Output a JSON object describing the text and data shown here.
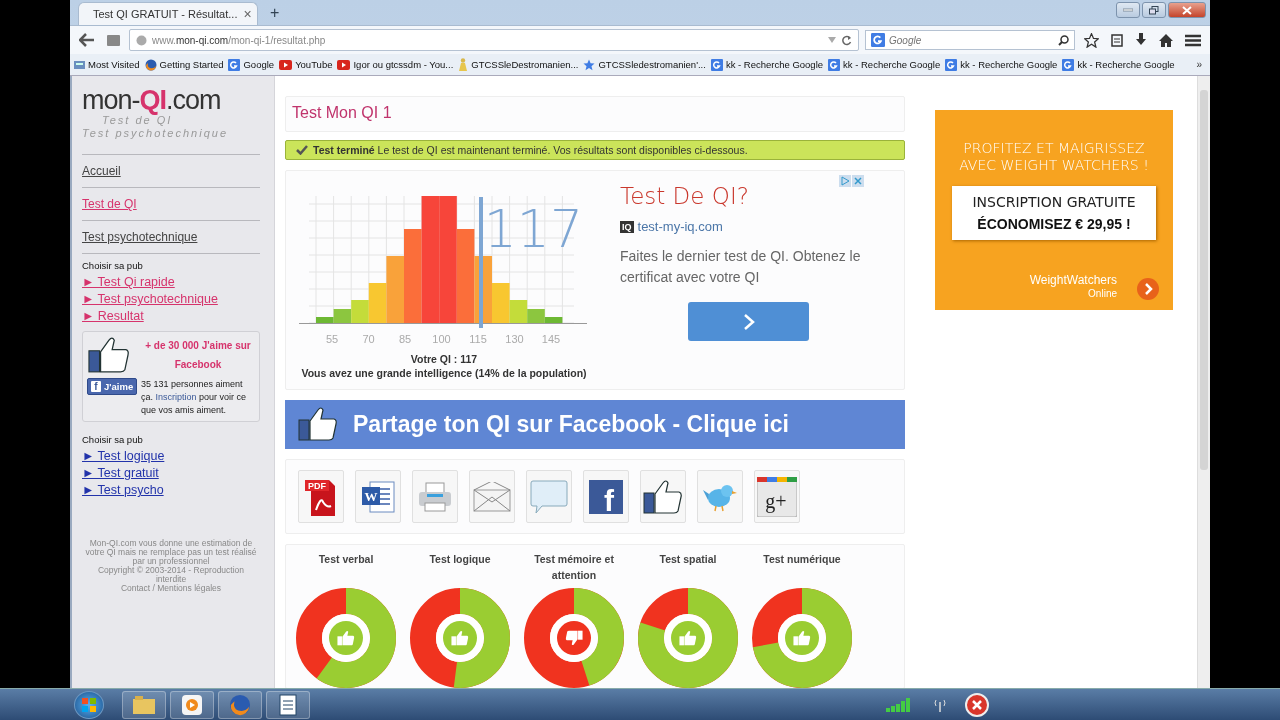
{
  "browser": {
    "tab": {
      "title": "Test QI GRATUIT - Résultat...",
      "close": "×"
    },
    "new_tab": "+",
    "url": "www.**mon-qi.com**/mon-qi-1/resultat.php",
    "search": {
      "placeholder": "Google"
    },
    "bookmarks": [
      {
        "kind": "folder",
        "label": "Most Visited"
      },
      {
        "kind": "firefox",
        "label": "Getting Started"
      },
      {
        "kind": "google",
        "label": "Google"
      },
      {
        "kind": "youtube",
        "label": "YouTube"
      },
      {
        "kind": "youtube",
        "label": "Igor ou gtcssdm - You..."
      },
      {
        "kind": "figure",
        "label": "GTCSSleDestromanien..."
      },
      {
        "kind": "star",
        "label": "GTCSSledestromanien'..."
      },
      {
        "kind": "google",
        "label": "kk - Recherche Google"
      },
      {
        "kind": "google",
        "label": "kk - Recherche Google"
      },
      {
        "kind": "google",
        "label": "kk - Recherche Google"
      },
      {
        "kind": "google",
        "label": "kk - Recherche Google"
      }
    ],
    "bookmarks_more": "»"
  },
  "sidebar": {
    "logo": {
      "left": "mon-",
      "mark": "QI",
      "right": ".com",
      "taglines": [
        "Test de QI",
        "Test psychotechnique"
      ]
    },
    "nav": [
      {
        "label": "Accueil",
        "selected": false
      },
      {
        "label": "Test de QI",
        "selected": true
      },
      {
        "label": "Test psychotechnique",
        "selected": false
      }
    ],
    "ad_groups": [
      {
        "label": "Choisir sa pub",
        "color": "#d6336c",
        "links": [
          "► Test Qi rapide",
          "► Test psychotechnique",
          "► Resultat"
        ]
      },
      {
        "label": "Choisir sa pub",
        "color": "#2233aa",
        "links": [
          "► Test logique",
          "► Test gratuit",
          "► Test psycho"
        ]
      }
    ],
    "facebook_box": {
      "headline": "+ de 30 000 J'aime sur Facebook",
      "like_button": {
        "glyph": "f",
        "label": "J'aime"
      },
      "count_text": "35 131 personnes aiment ça.",
      "link": "Inscription",
      "after_link": "pour voir ce que vos amis aiment."
    },
    "footer": [
      "Mon-QI.com vous donne une estimation de votre QI mais ne remplace pas un test réalisé par un professionnel",
      "Copyright © 2003-2014 - Reproduction interdite",
      "Contact / Mentions légales"
    ]
  },
  "main": {
    "title": "Test Mon QI 1",
    "alert": "**Test terminé** Le test de QI est maintenant terminé. Vos résultats sont disponibles ci-dessous.",
    "result": {
      "score": "117",
      "axis_labels": [
        "55",
        "70",
        "85",
        "100",
        "115",
        "130",
        "145"
      ],
      "caption": "Votre QI : 117",
      "summary": "Vous avez une grande intelligence (14% de la population)"
    },
    "ad": {
      "title": "Test De QI?",
      "badge": "IQ",
      "domain": "test-my-iq.com",
      "text": "Faites le dernier test de QI. Obtenez le certificat avec votre QI"
    },
    "share_banner": "Partage ton QI sur Facebook - Clique ici",
    "share_buttons": [
      {
        "kind": "pdf",
        "glyph": "PDF"
      },
      {
        "kind": "word",
        "glyph": "W"
      },
      {
        "kind": "print"
      },
      {
        "kind": "mail"
      },
      {
        "kind": "comment"
      },
      {
        "kind": "facebook",
        "glyph": "f"
      },
      {
        "kind": "like"
      },
      {
        "kind": "bird"
      },
      {
        "kind": "googleplus",
        "glyph": "g+"
      }
    ],
    "scores": [
      {
        "label": "Test verbal",
        "passed": true
      },
      {
        "label": "Test logique",
        "passed": true
      },
      {
        "label": "Test mémoire et attention",
        "passed": false
      },
      {
        "label": "Test spatial",
        "passed": true
      },
      {
        "label": "Test numérique",
        "passed": true
      }
    ]
  },
  "right_ad": {
    "headline": "PROFITEZ ET MAIGRISSEZ AVEC WEIGHT WATCHERS !",
    "offer": "INSCRIPTION GRATUITE",
    "price": "ÉCONOMISEZ € 29,95 !",
    "brand": "WeightWatchers",
    "brand_sub": "Online"
  }
}
